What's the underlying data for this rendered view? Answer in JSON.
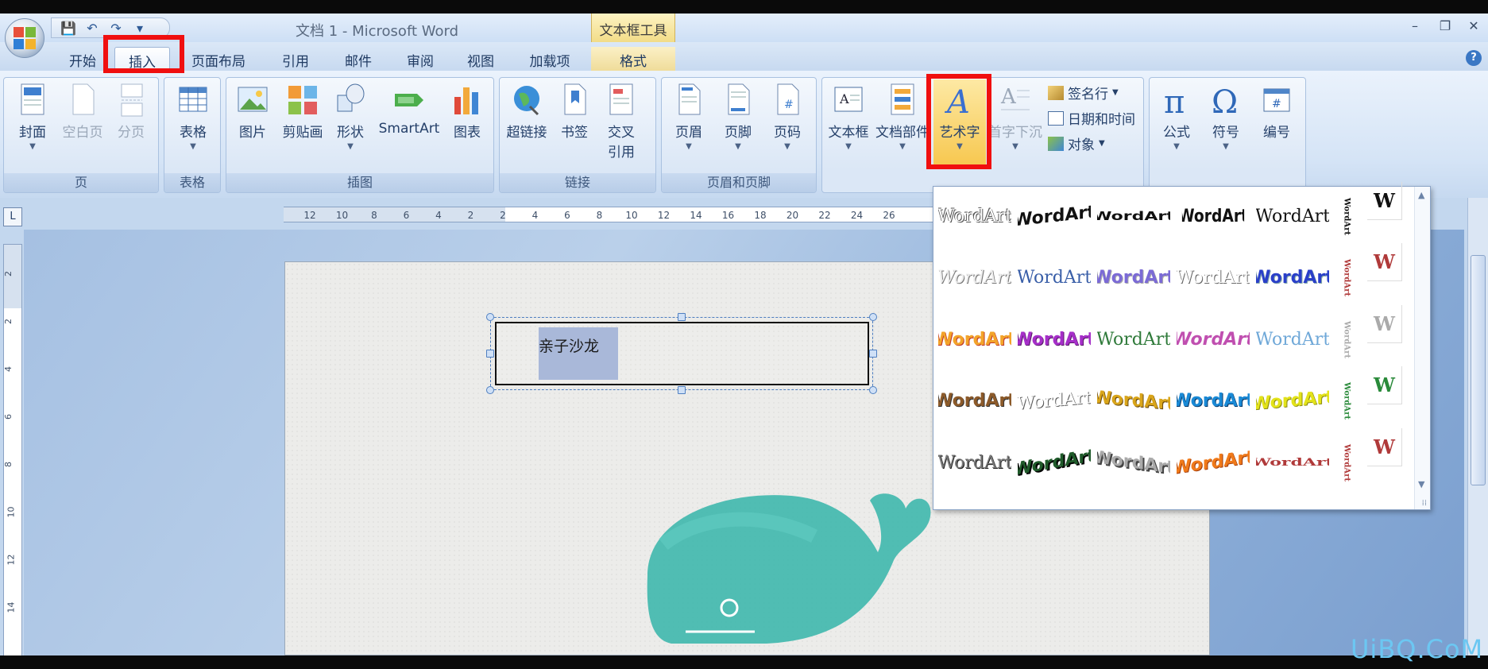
{
  "window": {
    "title": "文档 1 - Microsoft Word",
    "context_group": "文本框工具",
    "controls": {
      "minimize": "–",
      "restore": "❐",
      "close": "✕"
    },
    "help": "?"
  },
  "qat": {
    "save": "💾",
    "undo": "↶",
    "redo": "↷",
    "more": "▾"
  },
  "tabs": {
    "home": "开始",
    "insert": "插入",
    "page_layout": "页面布局",
    "references": "引用",
    "mailings": "邮件",
    "review": "审阅",
    "view": "视图",
    "addins": "加载项",
    "format": "格式"
  },
  "ribbon": {
    "pages": {
      "label": "页",
      "cover": "封面",
      "blank": "空白页",
      "break": "分页"
    },
    "tables": {
      "label": "表格",
      "table": "表格"
    },
    "illustrations": {
      "label": "插图",
      "picture": "图片",
      "clipart": "剪贴画",
      "shapes": "形状",
      "smartart": "SmartArt",
      "chart": "图表"
    },
    "links": {
      "label": "链接",
      "hyperlink": "超链接",
      "bookmark": "书签",
      "crossref_1": "交叉",
      "crossref_2": "引用"
    },
    "header_footer": {
      "label": "页眉和页脚",
      "header": "页眉",
      "footer": "页脚",
      "page_number": "页码"
    },
    "text": {
      "textbox": "文本框",
      "quickparts": "文档部件",
      "wordart": "艺术字",
      "dropcap": "首字下沉",
      "signature": "签名行",
      "datetime": "日期和时间",
      "object": "对象"
    },
    "symbols": {
      "equation": "公式",
      "symbol": "符号",
      "number": "编号"
    }
  },
  "ruler": {
    "h_ticks": [
      "12",
      "10",
      "8",
      "6",
      "4",
      "2",
      "2",
      "4",
      "6",
      "8",
      "10",
      "12",
      "14",
      "16",
      "18",
      "20",
      "22",
      "24",
      "26"
    ],
    "v_ticks": [
      "2",
      "2",
      "4",
      "6",
      "8",
      "10",
      "12",
      "14"
    ]
  },
  "document": {
    "textbox_text": "亲子沙龙"
  },
  "wordart_gallery": {
    "sample": "WordArt",
    "vertical_sample": "WordArt",
    "small_sample": "W"
  },
  "watermark": "UiBQ.CoM",
  "colors": {
    "highlight": "#f00f0f",
    "ribbon_bg": "#dbe7f6",
    "whale": "#3fb8ad"
  }
}
